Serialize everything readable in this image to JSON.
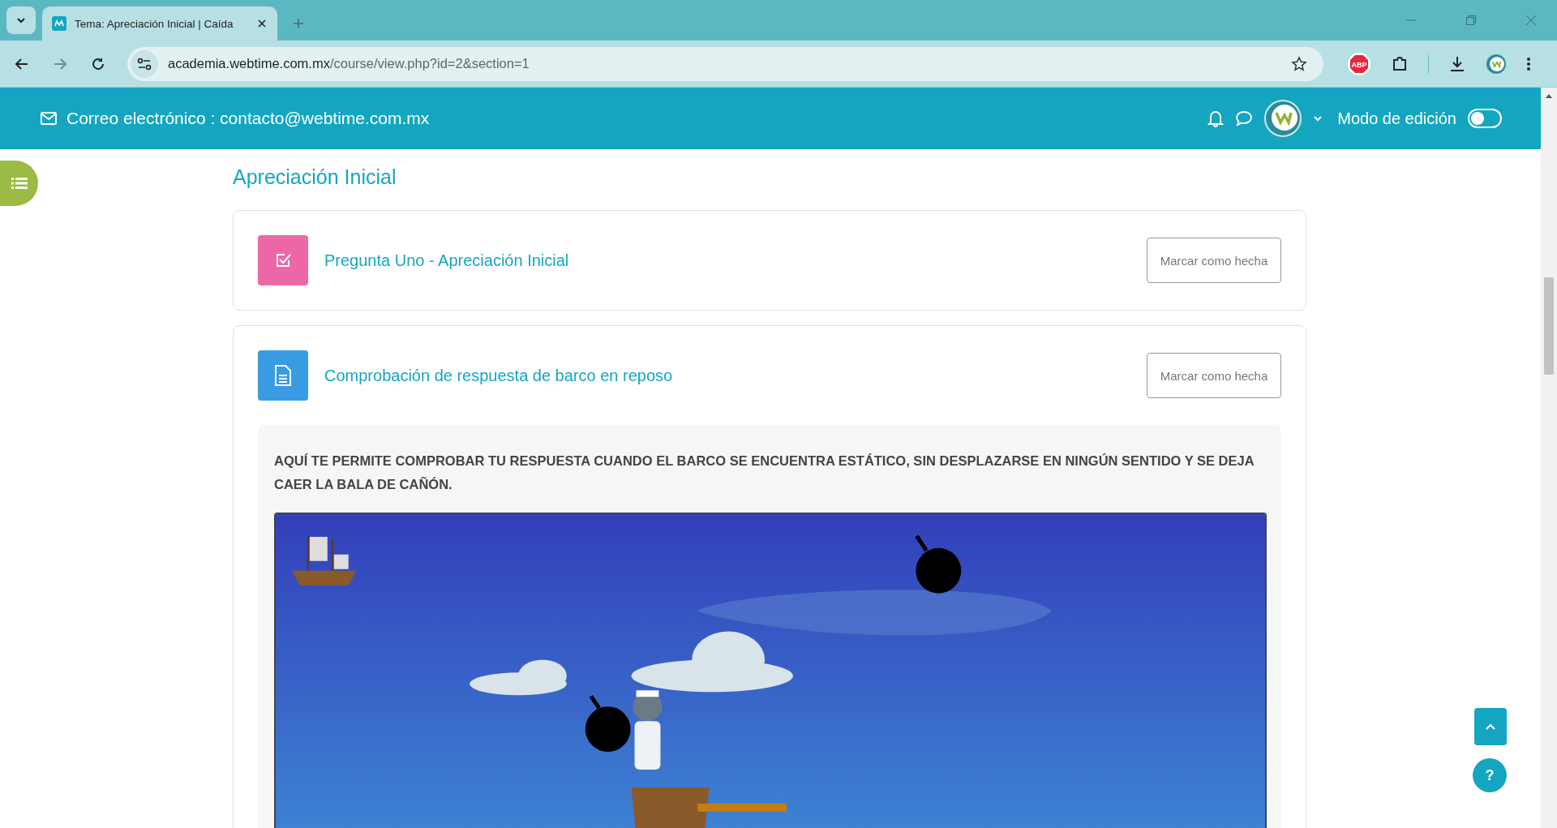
{
  "browser": {
    "tab_title": "Tema: Apreciación Inicial | Caída",
    "url_host": "academia.webtime.com.mx",
    "url_path": "/course/view.php?id=2&section=1",
    "bookmarked": false,
    "adblock_badge": "ABP"
  },
  "header": {
    "email_label": "Correo electrónico : contacto@webtime.com.mx",
    "edit_mode": {
      "label": "Modo de edición",
      "on": false
    }
  },
  "section": {
    "title": "Apreciación Inicial"
  },
  "activities": [
    {
      "kind": "quiz",
      "title": "Pregunta Uno - Apreciación Inicial",
      "button": "Marcar como hecha"
    },
    {
      "kind": "page",
      "title": "Comprobación de respuesta de barco en reposo",
      "button": "Marcar como hecha",
      "description": "AQUÍ TE PERMITE COMPROBAR TU RESPUESTA CUANDO EL BARCO SE ENCUENTRA ESTÁTICO, SIN DESPLAZARSE EN NINGÚN SENTIDO Y SE DEJA CAER LA BALA DE CAÑÓN."
    }
  ],
  "help_button": "?"
}
